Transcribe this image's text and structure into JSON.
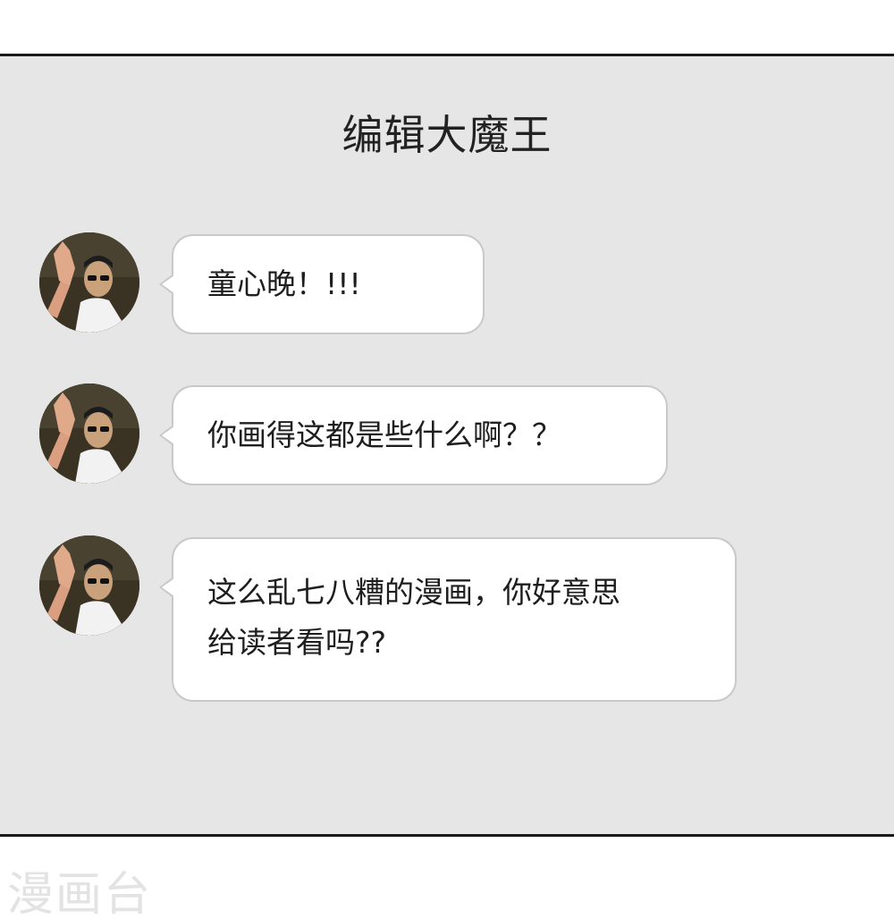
{
  "chat": {
    "title": "编辑大魔王",
    "messages": [
      {
        "lines": [
          "童心晚！!!!"
        ]
      },
      {
        "lines": [
          "你画得这都是些什么啊？？"
        ]
      },
      {
        "lines": [
          "这么乱七八糟的漫画，你好意思",
          "给读者看吗??"
        ]
      }
    ]
  },
  "watermark": "漫画台",
  "colors": {
    "panel_background": "#e6e6e6",
    "bubble_background": "#ffffff",
    "bubble_border": "#c9c9c9",
    "panel_border": "#1a1a1a"
  }
}
